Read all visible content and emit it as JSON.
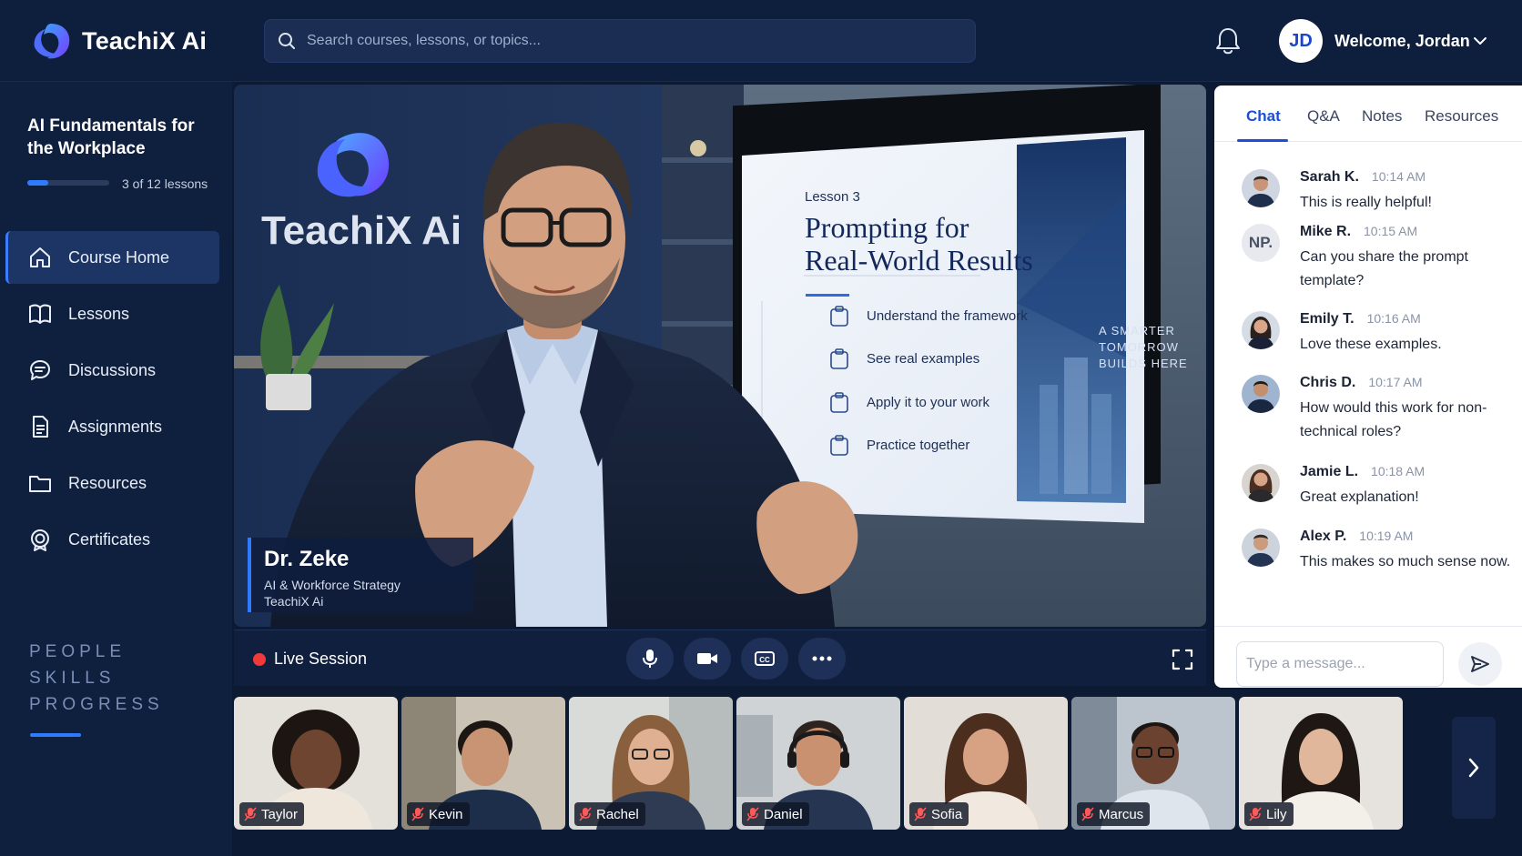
{
  "brand": {
    "name": "TeachiX Ai"
  },
  "search": {
    "placeholder": "Search courses, lessons, or topics..."
  },
  "user": {
    "initials": "JD",
    "welcome": "Welcome, Jordan"
  },
  "course": {
    "title": "AI Fundamentals for the Workplace",
    "progress_label": "3 of 12 lessons",
    "progress_fraction": 0.25
  },
  "sidebar": {
    "items": [
      {
        "label": "Course Home",
        "icon": "home-icon"
      },
      {
        "label": "Lessons",
        "icon": "book-icon"
      },
      {
        "label": "Discussions",
        "icon": "chat-bubble-icon"
      },
      {
        "label": "Assignments",
        "icon": "document-icon"
      },
      {
        "label": "Resources",
        "icon": "folder-icon"
      },
      {
        "label": "Certificates",
        "icon": "certificate-icon"
      }
    ],
    "tagline": [
      "PEOPLE",
      "SKILLS",
      "PROGRESS"
    ]
  },
  "video": {
    "backdrop_logo": "TeachiX Ai",
    "slide": {
      "lesson": "Lesson 3",
      "title_line1": "Prompting for",
      "title_line2": "Real-World Results",
      "items": [
        "Understand the framework",
        "See real examples",
        "Apply it to your work",
        "Practice together"
      ],
      "side_text": [
        "A SMARTER",
        "TOMORROW",
        "BUILDS HERE"
      ]
    },
    "speaker": {
      "name": "Dr. Zeke",
      "role": "AI & Workforce Strategy",
      "org": "TeachiX Ai"
    }
  },
  "controls": {
    "live_label": "Live Session",
    "buttons": [
      "microphone-icon",
      "camera-icon",
      "captions-icon",
      "more-icon"
    ],
    "live_color": "#f03a3a"
  },
  "chat": {
    "tabs": [
      "Chat",
      "Q&A",
      "Notes",
      "Resources"
    ],
    "messages": [
      {
        "name": "Sarah K.",
        "time": "10:14 AM",
        "text": "This is really helpful!"
      },
      {
        "name": "Mike R.",
        "time": "10:15 AM",
        "text": "Can you share the prompt template?",
        "initials": "NP."
      },
      {
        "name": "Emily T.",
        "time": "10:16 AM",
        "text": "Love these examples."
      },
      {
        "name": "Chris D.",
        "time": "10:17 AM",
        "text": "How would this work for non-technical roles?"
      },
      {
        "name": "Jamie L.",
        "time": "10:18 AM",
        "text": "Great explanation!"
      },
      {
        "name": "Alex P.",
        "time": "10:19 AM",
        "text": "This makes so much sense now."
      }
    ],
    "input_placeholder": "Type a message..."
  },
  "participants": [
    {
      "name": "Taylor"
    },
    {
      "name": "Kevin"
    },
    {
      "name": "Rachel"
    },
    {
      "name": "Daniel"
    },
    {
      "name": "Sofia"
    },
    {
      "name": "Marcus"
    },
    {
      "name": "Lily"
    }
  ],
  "colors": {
    "accent": "#2f7bff",
    "panel": "#0f1f3e",
    "chat_accent": "#1a4fd6"
  }
}
